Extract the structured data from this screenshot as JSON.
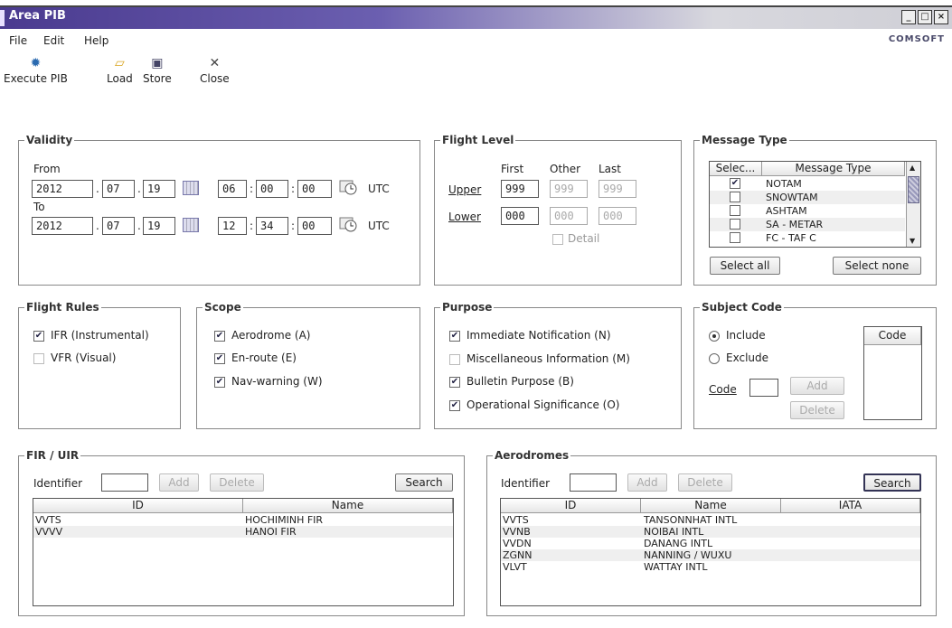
{
  "window": {
    "title": "Area PIB",
    "brand": "COMSOFT"
  },
  "menu": [
    "File",
    "Edit",
    "Help"
  ],
  "toolbar": {
    "execute": "Execute PIB",
    "load": "Load",
    "store": "Store",
    "close": "Close"
  },
  "validity": {
    "legend": "Validity",
    "from_label": "From",
    "to_label": "To",
    "utc": "UTC",
    "from": {
      "year": "2012",
      "month": "07",
      "day": "19",
      "hh": "06",
      "mm": "00",
      "ss": "00"
    },
    "to": {
      "year": "2012",
      "month": "07",
      "day": "19",
      "hh": "12",
      "mm": "34",
      "ss": "00"
    }
  },
  "flight_level": {
    "legend": "Flight Level",
    "cols": {
      "first": "First",
      "other": "Other",
      "last": "Last"
    },
    "upper_label": "Upper",
    "lower_label": "Lower",
    "upper": {
      "first": "999",
      "other": "999",
      "last": "999"
    },
    "lower": {
      "first": "000",
      "other": "000",
      "last": "000"
    },
    "detail": "Detail"
  },
  "message_type": {
    "legend": "Message Type",
    "col_select": "Selec...",
    "col_type": "Message Type",
    "rows": [
      {
        "checked": true,
        "name": "NOTAM"
      },
      {
        "checked": false,
        "name": "SNOWTAM"
      },
      {
        "checked": false,
        "name": "ASHTAM"
      },
      {
        "checked": false,
        "name": "SA - METAR"
      },
      {
        "checked": false,
        "name": "FC - TAF C"
      }
    ],
    "select_all": "Select all",
    "select_none": "Select none"
  },
  "flight_rules": {
    "legend": "Flight Rules",
    "ifr": "IFR (Instrumental)",
    "vfr": "VFR (Visual)",
    "ifr_checked": true,
    "vfr_checked": false
  },
  "scope": {
    "legend": "Scope",
    "aerodrome": "Aerodrome (A)",
    "enroute": "En-route (E)",
    "navwarning": "Nav-warning (W)"
  },
  "purpose": {
    "legend": "Purpose",
    "immediate": "Immediate Notification (N)",
    "misc": "Miscellaneous Information (M)",
    "bulletin": "Bulletin Purpose (B)",
    "operational": "Operational Significance (O)"
  },
  "subject_code": {
    "legend": "Subject Code",
    "include": "Include",
    "exclude": "Exclude",
    "code_label": "Code",
    "add": "Add",
    "delete": "Delete",
    "col_code": "Code"
  },
  "fir": {
    "legend": "FIR / UIR",
    "identifier": "Identifier",
    "add": "Add",
    "delete": "Delete",
    "search": "Search",
    "cols": {
      "id": "ID",
      "name": "Name"
    },
    "rows": [
      {
        "id": "VVTS",
        "name": "HOCHIMINH FIR"
      },
      {
        "id": "VVVV",
        "name": "HANOI FIR"
      }
    ]
  },
  "aerodromes": {
    "legend": "Aerodromes",
    "identifier": "Identifier",
    "add": "Add",
    "delete": "Delete",
    "search": "Search",
    "cols": {
      "id": "ID",
      "name": "Name",
      "iata": "IATA"
    },
    "rows": [
      {
        "id": "VVTS",
        "name": "TANSONNHAT INTL",
        "iata": ""
      },
      {
        "id": "VVNB",
        "name": "NOIBAI INTL",
        "iata": ""
      },
      {
        "id": "VVDN",
        "name": "DANANG INTL",
        "iata": ""
      },
      {
        "id": "ZGNN",
        "name": "NANNING / WUXU",
        "iata": ""
      },
      {
        "id": "VLVT",
        "name": "WATTAY INTL",
        "iata": ""
      }
    ]
  }
}
